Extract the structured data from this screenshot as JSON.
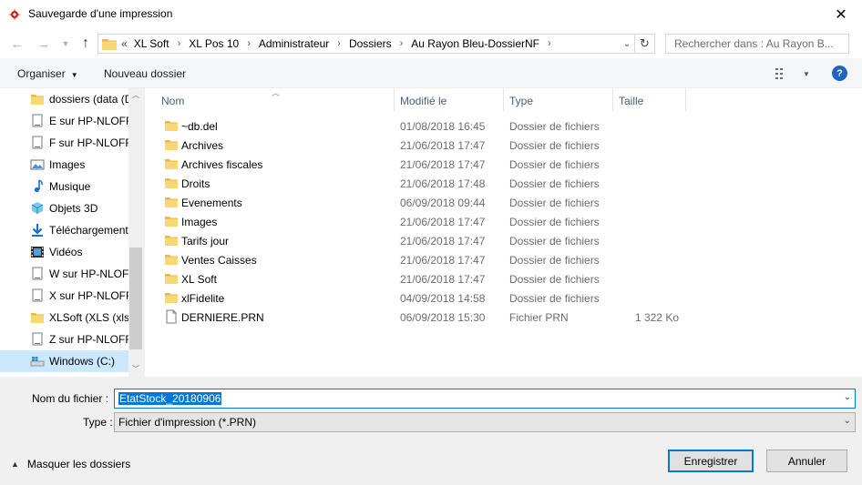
{
  "window": {
    "title": "Sauvegarde d'une impression",
    "close_glyph": "✕"
  },
  "address": {
    "more_glyph": "«",
    "crumbs": [
      "XL Soft",
      "XL Pos 10",
      "Administrateur",
      "Dossiers",
      "Au Rayon Bleu-DossierNF"
    ],
    "search_placeholder": "Rechercher dans : Au Rayon B..."
  },
  "toolbar": {
    "organize_label": "Organiser",
    "new_folder_label": "Nouveau dossier",
    "help_label": "?"
  },
  "nav": {
    "items": [
      {
        "label": "dossiers (data (D",
        "icon": "folder-icon"
      },
      {
        "label": "E sur HP-NLOFF",
        "icon": "network-drive-icon"
      },
      {
        "label": "F sur HP-NLOFF",
        "icon": "network-drive-icon"
      },
      {
        "label": "Images",
        "icon": "pictures-icon"
      },
      {
        "label": "Musique",
        "icon": "music-icon"
      },
      {
        "label": "Objets 3D",
        "icon": "objects-3d-icon"
      },
      {
        "label": "Téléchargement",
        "icon": "download-icon"
      },
      {
        "label": "Vidéos",
        "icon": "video-icon"
      },
      {
        "label": "W sur HP-NLOFF",
        "icon": "network-drive-icon"
      },
      {
        "label": "X sur HP-NLOFF",
        "icon": "network-drive-icon"
      },
      {
        "label": "XLSoft (XLS (xls))",
        "icon": "folder-icon"
      },
      {
        "label": "Z sur HP-NLOFF",
        "icon": "network-drive-icon"
      },
      {
        "label": "Windows (C:)",
        "icon": "windows-drive-icon",
        "selected": true
      }
    ]
  },
  "files": {
    "columns": {
      "name": "Nom",
      "date": "Modifié le",
      "type": "Type",
      "size": "Taille"
    },
    "rows": [
      {
        "name": "~db.del",
        "date": "01/08/2018 16:45",
        "type": "Dossier de fichiers",
        "size": "",
        "kind": "folder"
      },
      {
        "name": "Archives",
        "date": "21/06/2018 17:47",
        "type": "Dossier de fichiers",
        "size": "",
        "kind": "folder"
      },
      {
        "name": "Archives fiscales",
        "date": "21/06/2018 17:47",
        "type": "Dossier de fichiers",
        "size": "",
        "kind": "folder"
      },
      {
        "name": "Droits",
        "date": "21/06/2018 17:48",
        "type": "Dossier de fichiers",
        "size": "",
        "kind": "folder"
      },
      {
        "name": "Evenements",
        "date": "06/09/2018 09:44",
        "type": "Dossier de fichiers",
        "size": "",
        "kind": "folder"
      },
      {
        "name": "Images",
        "date": "21/06/2018 17:47",
        "type": "Dossier de fichiers",
        "size": "",
        "kind": "folder"
      },
      {
        "name": "Tarifs jour",
        "date": "21/06/2018 17:47",
        "type": "Dossier de fichiers",
        "size": "",
        "kind": "folder"
      },
      {
        "name": "Ventes Caisses",
        "date": "21/06/2018 17:47",
        "type": "Dossier de fichiers",
        "size": "",
        "kind": "folder"
      },
      {
        "name": "XL Soft",
        "date": "21/06/2018 17:47",
        "type": "Dossier de fichiers",
        "size": "",
        "kind": "folder"
      },
      {
        "name": "xlFidelite",
        "date": "04/09/2018 14:58",
        "type": "Dossier de fichiers",
        "size": "",
        "kind": "folder"
      },
      {
        "name": "DERNIERE.PRN",
        "date": "06/09/2018 15:30",
        "type": "Fichier PRN",
        "size": "1 322 Ko",
        "kind": "file"
      }
    ]
  },
  "form": {
    "filename_label": "Nom du fichier :",
    "filename_value": "EtatStock_20180906",
    "type_label": "Type :",
    "type_value": "Fichier d'impression (*.PRN)"
  },
  "footer": {
    "hide_folders_label": "Masquer les dossiers",
    "save_label": "Enregistrer",
    "cancel_label": "Annuler"
  },
  "colors": {
    "accent": "#0078d7",
    "folder": "#f8d775",
    "selection": "#cce8ff"
  }
}
